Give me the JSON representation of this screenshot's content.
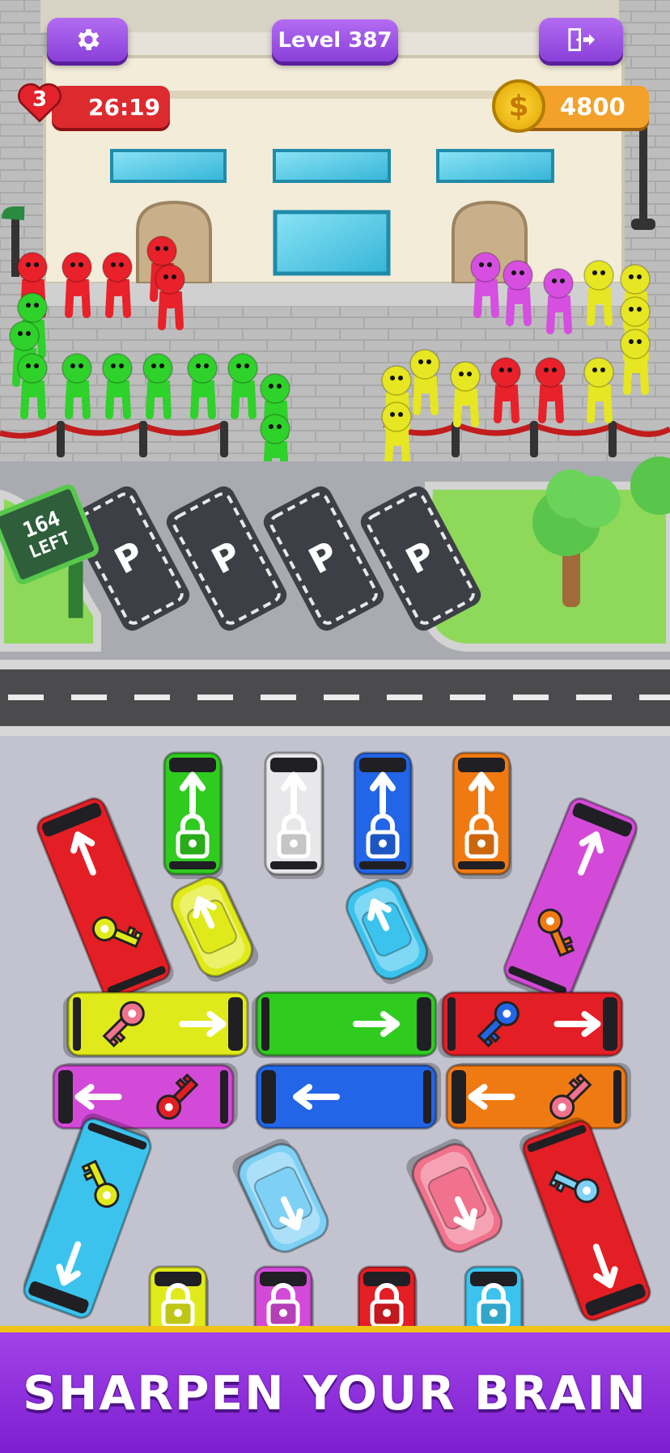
{
  "hud": {
    "settings_icon": "gear-icon",
    "level_label": "Level 387",
    "exit_icon": "exit-door-icon",
    "lives": "3",
    "lives_icon": "heart-icon",
    "timer": "26:19",
    "coin_icon": "dollar-coin-icon",
    "coins": "4800"
  },
  "sign": {
    "count": "164",
    "label": "LEFT"
  },
  "parking": {
    "spot_label": "P",
    "spots": 4
  },
  "crowd": {
    "colors": {
      "green": "#2fd12b",
      "red": "#e8212a",
      "pink": "#d64fe0",
      "yellow": "#e6e622"
    }
  },
  "vehicles": {
    "palette": {
      "green": "#2fcb1f",
      "white": "#e8e8ea",
      "blue": "#2265e6",
      "orange": "#f07a12",
      "red": "#e31e24",
      "magenta": "#d44ad8",
      "lime": "#e0ea1a",
      "cyan": "#3bc3ee",
      "lightblue": "#7fd0f5",
      "pink": "#f0728c"
    }
  },
  "banner": {
    "text": "SHARPEN YOUR BRAIN"
  }
}
